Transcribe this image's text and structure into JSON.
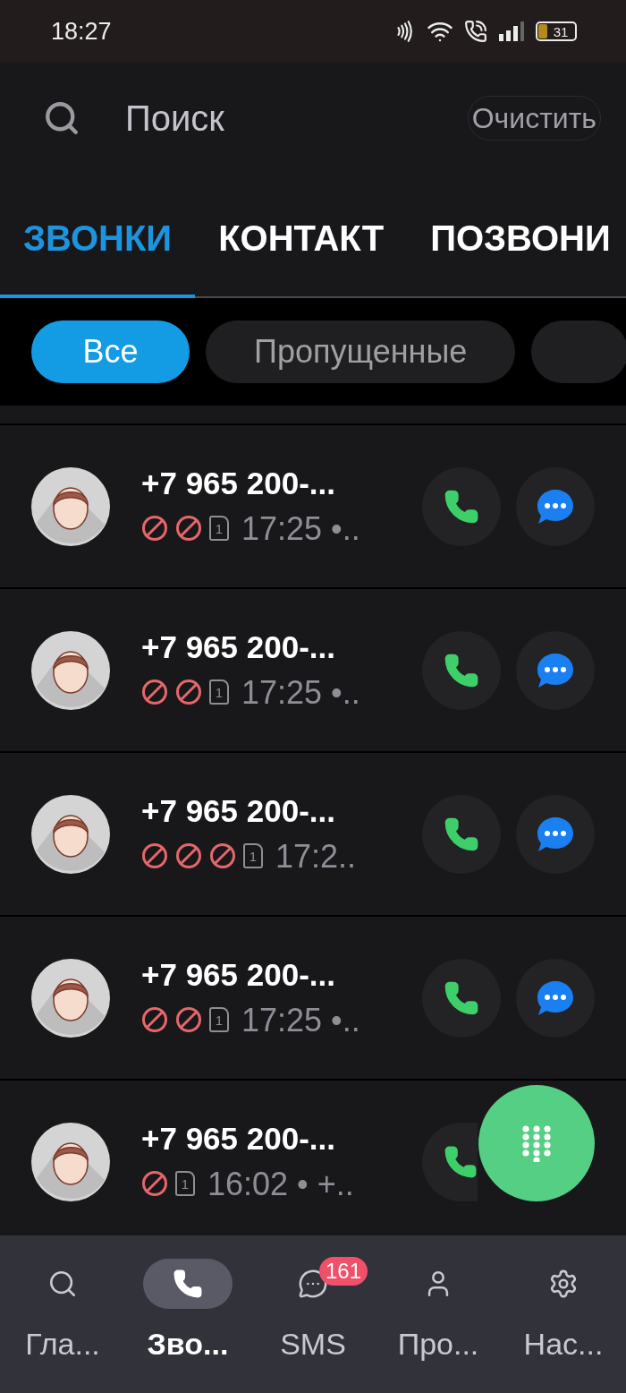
{
  "status_bar": {
    "time": "18:27",
    "battery": "31"
  },
  "search": {
    "placeholder": "Поиск",
    "clear_button": "Очистить"
  },
  "tabs": [
    {
      "label": "ЗВОНКИ",
      "selected": true
    },
    {
      "label": "КОНТАКТ",
      "selected": false
    },
    {
      "label": "ПОЗВОНИ",
      "selected": false
    }
  ],
  "filters": [
    {
      "label": "Все",
      "selected": true
    },
    {
      "label": "Пропущенные",
      "selected": false
    },
    {
      "selected": false
    }
  ],
  "calls": [
    {
      "number": "+7 965 200-...",
      "icons": [
        {
          "kind": "blocked"
        },
        {
          "kind": "blocked"
        },
        {
          "kind": "sim",
          "label": "1"
        }
      ],
      "details": "17:25 •..",
      "message_button": true
    },
    {
      "number": "+7 965 200-...",
      "icons": [
        {
          "kind": "blocked"
        },
        {
          "kind": "blocked"
        },
        {
          "kind": "sim",
          "label": "1"
        }
      ],
      "details": "17:25 •..",
      "message_button": true
    },
    {
      "number": "+7 965 200-...",
      "icons": [
        {
          "kind": "blocked"
        },
        {
          "kind": "blocked"
        },
        {
          "kind": "blocked"
        },
        {
          "kind": "sim",
          "label": "1"
        }
      ],
      "details": "17:2..",
      "message_button": true
    },
    {
      "number": "+7 965 200-...",
      "icons": [
        {
          "kind": "blocked"
        },
        {
          "kind": "blocked"
        },
        {
          "kind": "sim",
          "label": "1"
        }
      ],
      "details": "17:25 •..",
      "message_button": true
    },
    {
      "number": "+7 965 200-...",
      "icons": [
        {
          "kind": "blocked"
        },
        {
          "kind": "sim",
          "label": "1"
        }
      ],
      "details": "16:02 • +..",
      "message_button": false
    }
  ],
  "nav": [
    {
      "kind": "search",
      "label": "Гла...",
      "selected": false
    },
    {
      "kind": "phone",
      "label": "Зво...",
      "selected": true
    },
    {
      "kind": "chat",
      "label": "SMS",
      "selected": false,
      "badge": "161"
    },
    {
      "kind": "profile",
      "label": "Про...",
      "selected": false
    },
    {
      "kind": "settings",
      "label": "Нас...",
      "selected": false
    }
  ]
}
